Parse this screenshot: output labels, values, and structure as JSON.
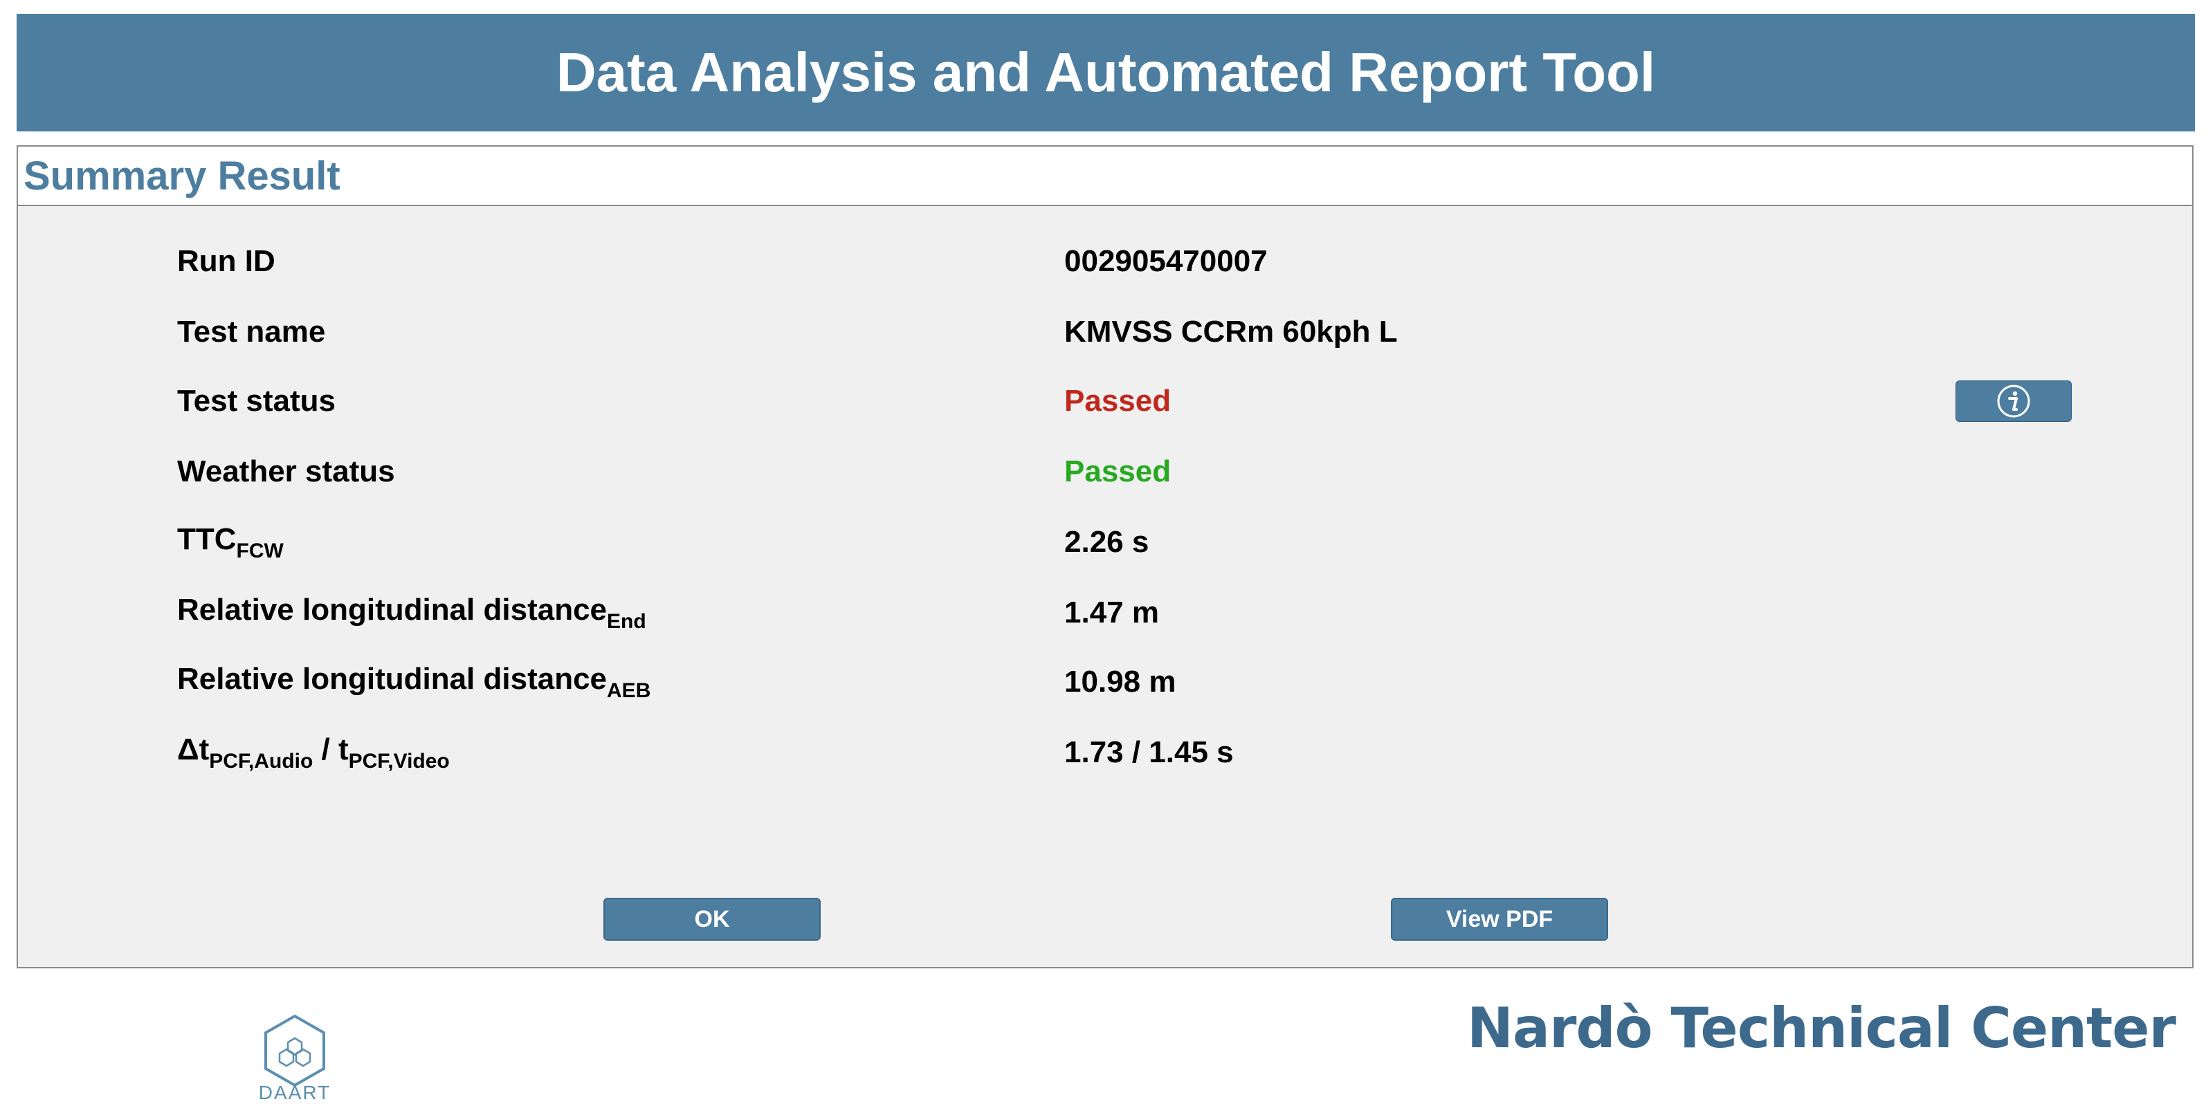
{
  "header": {
    "title": "Data Analysis and Automated Report Tool"
  },
  "panel": {
    "title": "Summary Result"
  },
  "rows": [
    {
      "label": "Run ID",
      "value": "002905470007"
    },
    {
      "label": "Test name",
      "value": "KMVSS CCRm 60kph L"
    },
    {
      "label": "Test status",
      "value": "Passed"
    },
    {
      "label": "Weather status",
      "value": "Passed"
    },
    {
      "label": "TTC",
      "label_sub": "FCW",
      "value": "2.26 s"
    },
    {
      "label": "Relative longitudinal distance",
      "label_sub": "End",
      "value": "1.47 m"
    },
    {
      "label": "Relative longitudinal distance",
      "label_sub": "AEB",
      "value": "10.98 m"
    },
    {
      "label": "Δt",
      "label_sub": "PCF,Audio",
      "label_mid": " / t",
      "label_sub2": "PCF,Video",
      "value": "1.73 / 1.45 s"
    }
  ],
  "buttons": {
    "ok": "OK",
    "view_pdf": "View PDF"
  },
  "footer": {
    "daart": "DAART",
    "company": "Nardò Technical Center"
  },
  "colors": {
    "accent": "#4d7ea0",
    "fail_red": "#c0281e",
    "pass_green": "#27a91f"
  },
  "icons": {
    "info": "info-icon",
    "logo": "daart-hexagon-logo-icon"
  }
}
